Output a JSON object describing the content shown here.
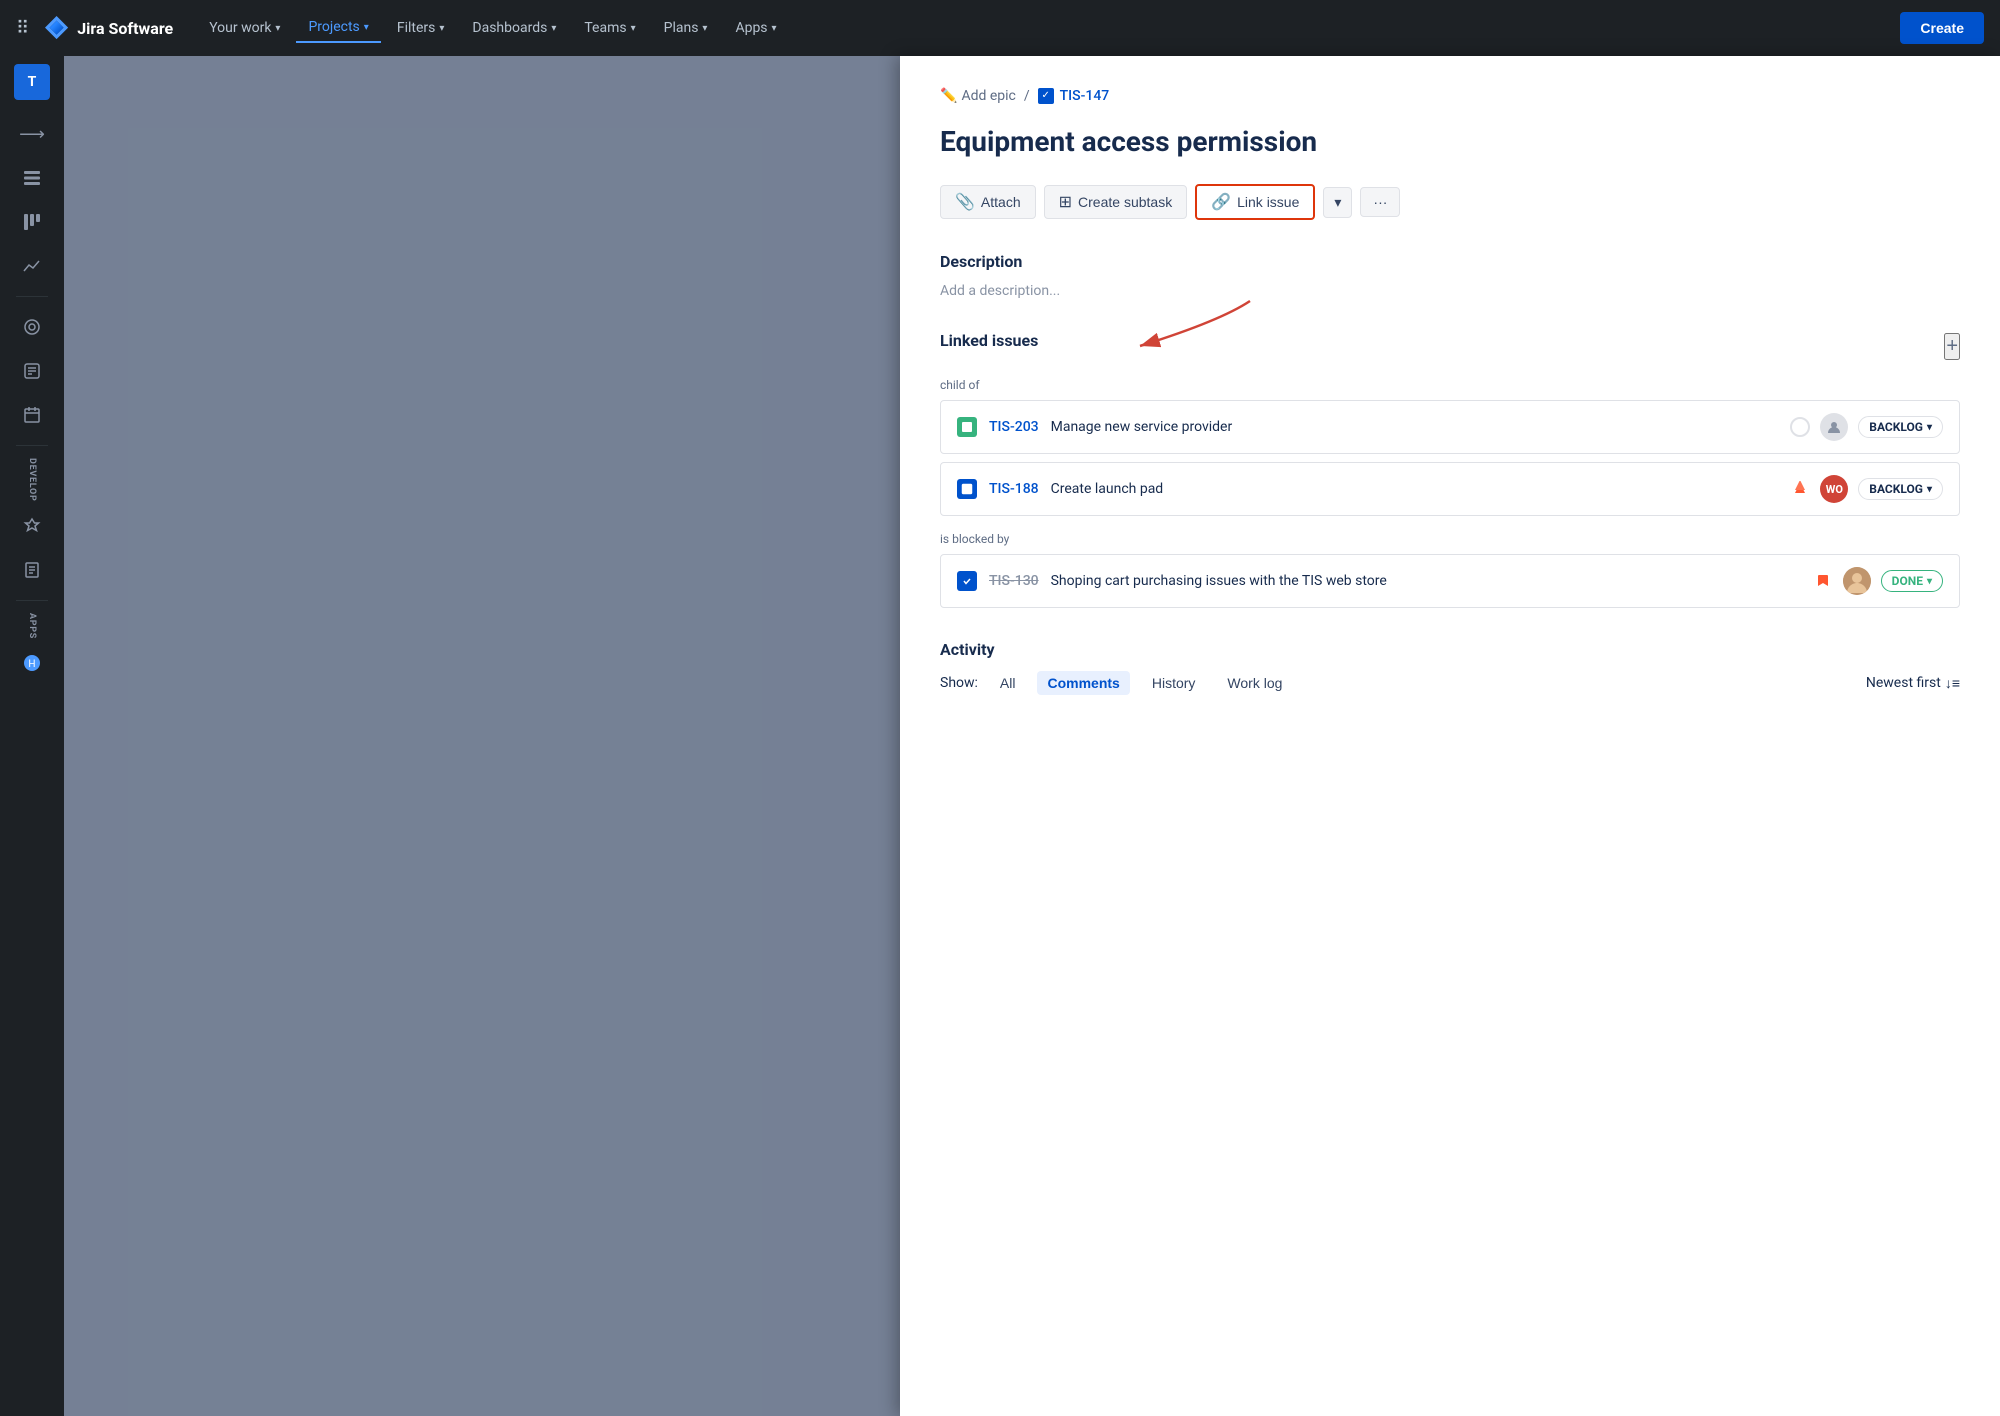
{
  "navbar": {
    "logo_text": "Jira Software",
    "nav_items": [
      {
        "id": "your-work",
        "label": "Your work",
        "active": false,
        "has_chevron": true
      },
      {
        "id": "projects",
        "label": "Projects",
        "active": true,
        "has_chevron": true
      },
      {
        "id": "filters",
        "label": "Filters",
        "active": false,
        "has_chevron": true
      },
      {
        "id": "dashboards",
        "label": "Dashboards",
        "active": false,
        "has_chevron": true
      },
      {
        "id": "teams",
        "label": "Teams",
        "active": false,
        "has_chevron": true
      },
      {
        "id": "plans",
        "label": "Plans",
        "active": false,
        "has_chevron": true
      },
      {
        "id": "apps",
        "label": "Apps",
        "active": false,
        "has_chevron": true
      }
    ],
    "create_button": "Create"
  },
  "breadcrumb": {
    "add_epic_label": "Add epic",
    "separator": "/",
    "ticket_id": "TIS-147"
  },
  "issue": {
    "title": "Equipment access permission",
    "buttons": {
      "attach": "Attach",
      "create_subtask": "Create subtask",
      "link_issue": "Link issue",
      "more": "···"
    }
  },
  "description": {
    "label": "Description",
    "placeholder": "Add a description..."
  },
  "linked_issues": {
    "label": "Linked issues",
    "add_icon": "+",
    "groups": [
      {
        "id": "child-of",
        "label": "child of",
        "issues": [
          {
            "id": "tis-203",
            "key": "TIS-203",
            "summary": "Manage new service provider",
            "type": "story",
            "strikethrough": false,
            "priority": null,
            "avatar_type": "default",
            "avatar_label": "",
            "status": "BACKLOG",
            "status_done": false
          },
          {
            "id": "tis-188",
            "key": "TIS-188",
            "summary": "Create launch pad",
            "type": "subtask",
            "strikethrough": false,
            "priority": "high",
            "avatar_type": "wo",
            "avatar_label": "WO",
            "status": "BACKLOG",
            "status_done": false
          }
        ]
      },
      {
        "id": "is-blocked-by",
        "label": "is blocked by",
        "issues": [
          {
            "id": "tis-130",
            "key": "TIS-130",
            "summary": "Shoping cart purchasing issues with the TIS web store",
            "type": "done",
            "strikethrough": true,
            "priority": "bookmark",
            "avatar_type": "photo",
            "avatar_label": "👤",
            "status": "DONE",
            "status_done": true
          }
        ]
      }
    ]
  },
  "activity": {
    "label": "Activity",
    "show_label": "Show:",
    "filters": [
      "All",
      "Comments",
      "History",
      "Work log"
    ],
    "active_filter": "Comments",
    "sort_label": "Newest first"
  }
}
